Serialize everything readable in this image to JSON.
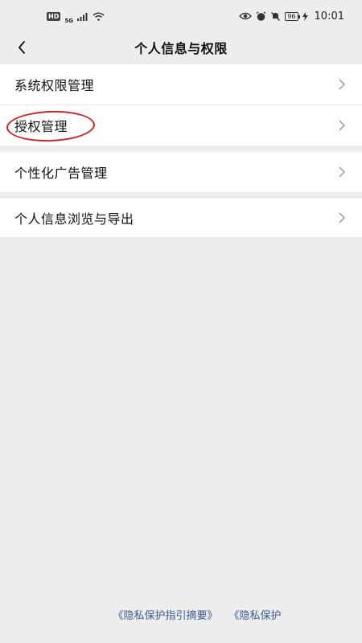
{
  "status_bar": {
    "hd_badge": "HD",
    "network": "5G",
    "battery": "96",
    "time": "10:01"
  },
  "nav": {
    "title": "个人信息与权限"
  },
  "sections": [
    {
      "items": [
        {
          "label": "系统权限管理"
        },
        {
          "label": "授权管理"
        }
      ]
    },
    {
      "items": [
        {
          "label": "个性化广告管理"
        }
      ]
    },
    {
      "items": [
        {
          "label": "个人信息浏览与导出"
        }
      ]
    }
  ],
  "footer": {
    "link1": "《隐私保护指引摘要》",
    "link2": "《隐私保护"
  },
  "colors": {
    "background": "#ededed",
    "row_bg": "#ffffff",
    "link": "#3a5a8f",
    "annotation_circle": "#d0242b"
  },
  "icons": [
    "back-chevron-icon",
    "chevron-right-icon",
    "wifi-icon",
    "signal-icon",
    "eye-icon",
    "alarm-icon",
    "mute-icon",
    "battery-icon",
    "charging-icon"
  ]
}
